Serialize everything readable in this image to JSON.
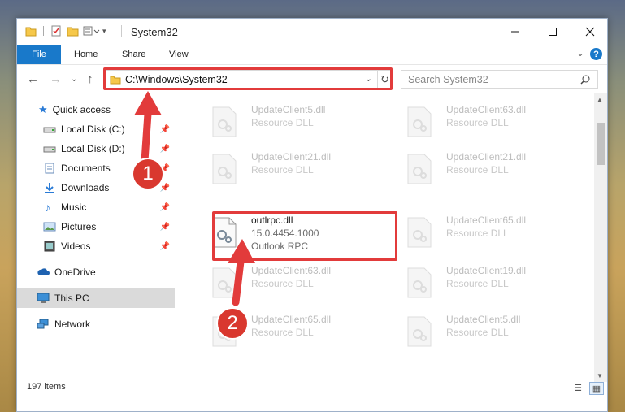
{
  "window": {
    "title": "System32",
    "quick_access_toolbar": [
      "folder-icon",
      "properties-icon",
      "new-folder-icon",
      "customize-icon"
    ],
    "controls": [
      "minimize",
      "maximize",
      "close"
    ]
  },
  "ribbon": {
    "tabs": [
      "File",
      "Home",
      "Share",
      "View"
    ],
    "help_label": "?"
  },
  "navigation": {
    "address": "C:\\Windows\\System32",
    "search_placeholder": "Search System32"
  },
  "sidebar": {
    "items": [
      {
        "label": "Quick access",
        "icon": "star-icon"
      },
      {
        "label": "Local Disk (C:)",
        "icon": "drive-icon",
        "pinned": true
      },
      {
        "label": "Local Disk (D:)",
        "icon": "drive-icon",
        "pinned": true
      },
      {
        "label": "Documents",
        "icon": "documents-icon",
        "pinned": true
      },
      {
        "label": "Downloads",
        "icon": "downloads-icon",
        "pinned": true
      },
      {
        "label": "Music",
        "icon": "music-icon",
        "pinned": true
      },
      {
        "label": "Pictures",
        "icon": "pictures-icon",
        "pinned": true
      },
      {
        "label": "Videos",
        "icon": "videos-icon",
        "pinned": true
      },
      {
        "label": "OneDrive",
        "icon": "cloud-icon"
      },
      {
        "label": "This PC",
        "icon": "pc-icon",
        "selected": true
      },
      {
        "label": "Network",
        "icon": "network-icon"
      }
    ]
  },
  "files": [
    {
      "name": "UpdateClient5.dll",
      "type": "Resource DLL"
    },
    {
      "name": "UpdateClient63.dll",
      "type": "Resource DLL"
    },
    {
      "name": "UpdateClient21.dll",
      "type": "Resource DLL"
    },
    {
      "name": "UpdateClient21.dll",
      "type": "Resource DLL"
    },
    {
      "name": "outlrpc.dll",
      "version": "15.0.4454.1000",
      "type": "Outlook RPC",
      "highlighted": true
    },
    {
      "name": "UpdateClient65.dll",
      "type": "Resource DLL"
    },
    {
      "name": "UpdateClient63.dll",
      "type": "Resource DLL"
    },
    {
      "name": "UpdateClient19.dll",
      "type": "Resource DLL"
    },
    {
      "name": "UpdateClient65.dll",
      "type": "Resource DLL"
    },
    {
      "name": "UpdateClient5.dll",
      "type": "Resource DLL"
    }
  ],
  "status": {
    "item_count": "197 items"
  },
  "callouts": {
    "one": "1",
    "two": "2"
  },
  "colors": {
    "accent": "#1979ca",
    "highlight": "#e23b3b",
    "selected_row": "#dadada"
  }
}
